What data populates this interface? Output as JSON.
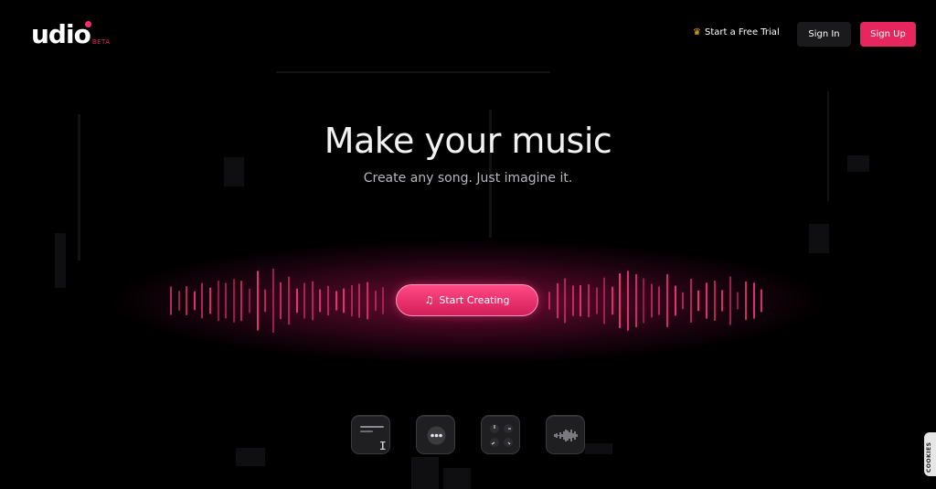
{
  "brand": {
    "name": "udio",
    "badge": "BETA"
  },
  "nav": {
    "trial_label": "Start a Free Trial",
    "signin_label": "Sign In",
    "signup_label": "Sign Up"
  },
  "hero": {
    "title": "Make your music",
    "subtitle": "Create any song. Just imagine it.",
    "cta_label": "Start Creating"
  },
  "features": [
    {
      "icon": "text-prompt-icon"
    },
    {
      "icon": "more-options-icon"
    },
    {
      "icon": "controls-knobs-icon"
    },
    {
      "icon": "audio-waveform-icon"
    }
  ],
  "cookie_tab": {
    "label": "COOKIES"
  },
  "colors": {
    "accent": "#e8265e",
    "background": "#000000",
    "crown": "#f3b524"
  }
}
